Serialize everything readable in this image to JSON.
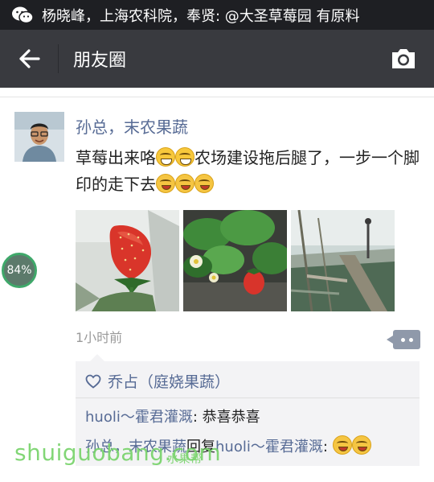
{
  "status_bar": {
    "notification_text": "杨晓峰，上海农科院，奉贤: @大圣草莓园 有原料",
    "app_icon": "wechat-icon"
  },
  "nav_bar": {
    "back_icon": "back-arrow-icon",
    "title": "朋友圈",
    "camera_icon": "camera-icon"
  },
  "post": {
    "author": "孙总，末农果蔬",
    "text_part1": "草莓出来咯",
    "text_part2": "农场建设拖后腿了，一步一个脚印的走下去",
    "photos": [
      "strawberry-closeup-photo",
      "strawberry-plant-photo",
      "farm-construction-photo"
    ],
    "time": "1小时前",
    "more_icon": "more-dots-icon"
  },
  "likes": {
    "icon": "heart-icon",
    "names": "乔占（庭娆果蔬）"
  },
  "comments": [
    {
      "author": "huoli～霍君灌溉",
      "separator": ": ",
      "text": "恭喜恭喜"
    },
    {
      "author": "孙总，末农果蔬",
      "reply_word": "回复",
      "target": "huoli～霍君灌溉",
      "separator": ": "
    }
  ],
  "overlay": {
    "progress": "84%",
    "watermark": "shuiguobang.com",
    "watermark_sub": "水果帮"
  }
}
